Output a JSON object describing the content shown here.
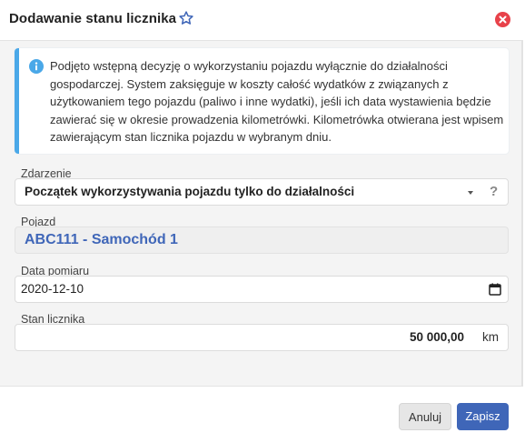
{
  "header": {
    "title": "Dodawanie stanu licznika",
    "icons": {
      "favorite": "star-icon",
      "close": "close-icon"
    }
  },
  "info": {
    "icon": "info-icon",
    "text": "Podjęto wstępną decyzję o wykorzystaniu pojazdu wyłącznie do działalności gospodarczej. System zaksięguje w koszty całość wydatków z związanych z użytkowaniem tego pojazdu (paliwo i inne wydatki), jeśli ich data wystawienia będzie zawierać się w okresie prowadzenia kilometrówki. Kilometrówka otwierana jest wpisem zawierającym stan licznika pojazdu w wybranym dniu."
  },
  "form": {
    "zdarzenie": {
      "label": "Zdarzenie",
      "value": "Początek wykorzystywania pojazdu tylko do działalności",
      "help": "?"
    },
    "pojazd": {
      "label": "Pojazd",
      "value": "ABC111 - Samochód 1"
    },
    "data_pomiaru": {
      "label": "Data pomiaru",
      "value": "2020-12-10"
    },
    "stan_licznika": {
      "label": "Stan licznika",
      "value": "50 000,00",
      "unit": "km"
    }
  },
  "footer": {
    "cancel_label": "Anuluj",
    "save_label": "Zapisz"
  },
  "colors": {
    "primary": "#3f66b8",
    "info": "#4aa8e8",
    "close": "#e8424a"
  }
}
